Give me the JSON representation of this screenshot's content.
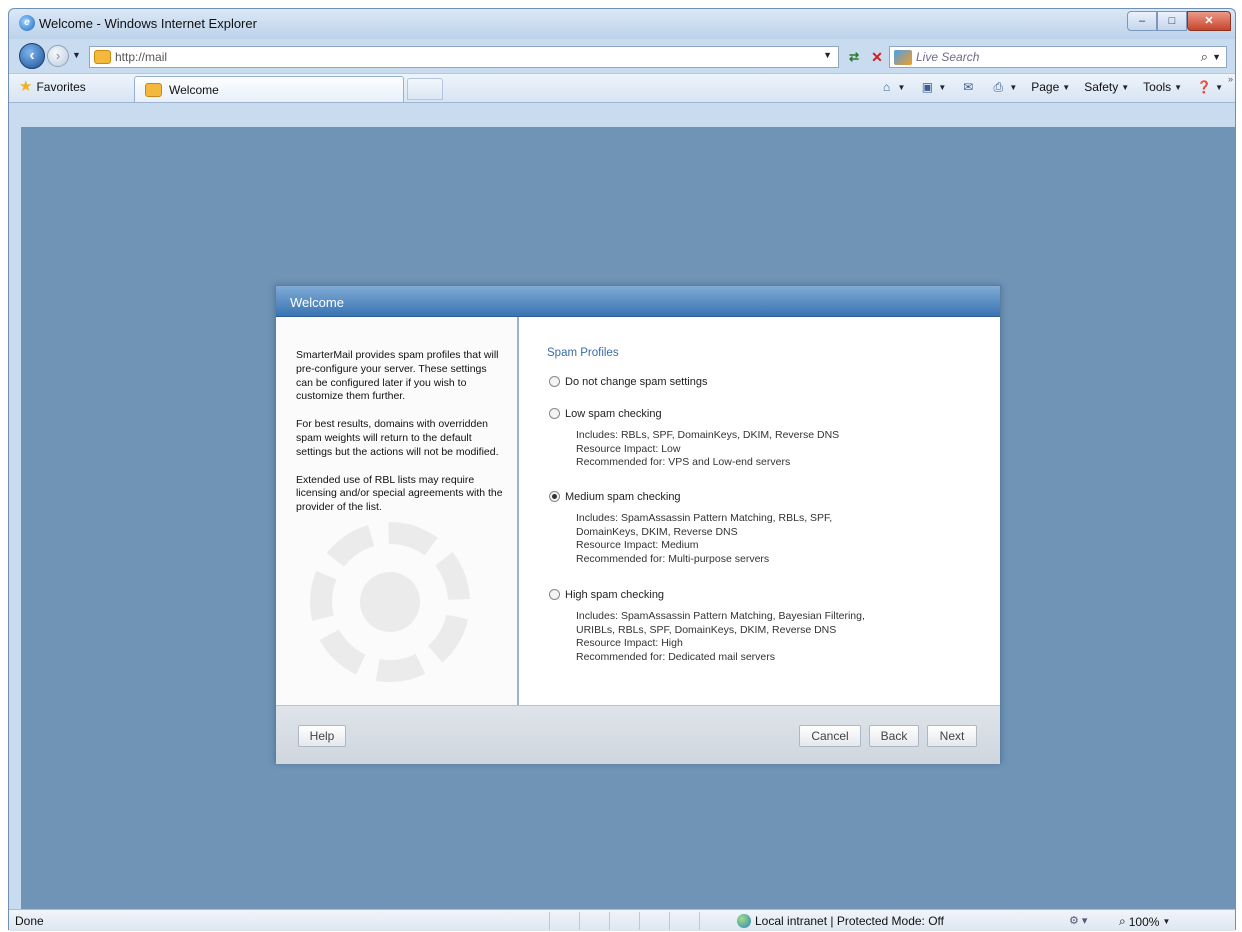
{
  "window": {
    "title": "Welcome - Windows Internet Explorer",
    "controls": {
      "minimize": "–",
      "maximize": "□",
      "close": "✕"
    }
  },
  "nav": {
    "address_url": "http://mail",
    "search_placeholder": "Live Search"
  },
  "favorites_bar": {
    "favorites_label": "Favorites",
    "tab_label": "Welcome"
  },
  "command_bar": {
    "page_label": "Page",
    "safety_label": "Safety",
    "tools_label": "Tools"
  },
  "dialog": {
    "title": "Welcome",
    "left_paragraphs": [
      "SmarterMail provides spam profiles that will pre-configure your server. These settings can be configured later if you wish to customize them further.",
      "For best results, domains with overridden spam weights will return to the default settings but the actions will not be modified.",
      "Extended use of RBL lists may require licensing and/or special agreements with the provider of the list."
    ],
    "section_title": "Spam Profiles",
    "options": [
      {
        "label": "Do not change spam settings",
        "selected": false,
        "details": []
      },
      {
        "label": "Low spam checking",
        "selected": false,
        "details": [
          "Includes: RBLs, SPF, DomainKeys, DKIM, Reverse DNS",
          "Resource Impact: Low",
          "Recommended for: VPS and Low-end servers"
        ]
      },
      {
        "label": "Medium spam checking",
        "selected": true,
        "details": [
          "Includes: SpamAssassin Pattern Matching, RBLs, SPF,",
          "DomainKeys, DKIM, Reverse DNS",
          "Resource Impact: Medium",
          "Recommended for: Multi-purpose servers"
        ]
      },
      {
        "label": "High spam checking",
        "selected": false,
        "details": [
          "Includes: SpamAssassin Pattern Matching, Bayesian Filtering,",
          "URIBLs, RBLs, SPF, DomainKeys, DKIM, Reverse DNS",
          "Resource Impact: High",
          "Recommended for: Dedicated mail servers"
        ]
      }
    ],
    "buttons": {
      "help": "Help",
      "cancel": "Cancel",
      "back": "Back",
      "next": "Next"
    }
  },
  "status_bar": {
    "status": "Done",
    "zone": "Local intranet | Protected Mode: Off",
    "zoom": "100%"
  },
  "colors": {
    "viewport_bg": "#6f94b6",
    "dialog_header": "#3a74b3",
    "section_title": "#3a6da8"
  }
}
